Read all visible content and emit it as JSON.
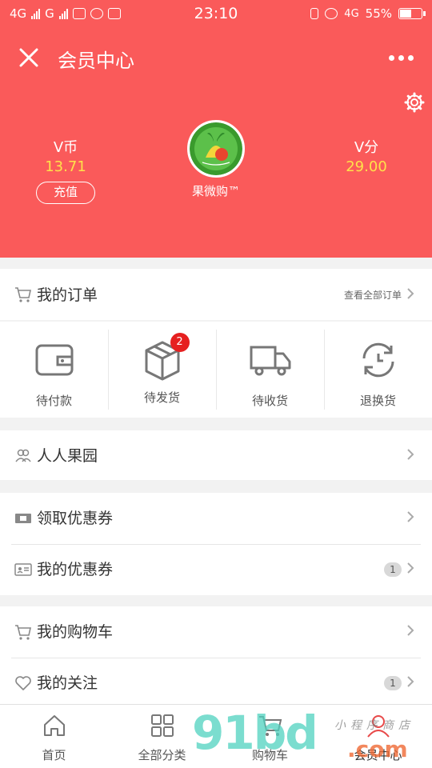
{
  "status_bar": {
    "left_net_1": "4G",
    "left_net_2": "G",
    "time": "23:10",
    "right_net": "4G",
    "battery": "55%"
  },
  "header": {
    "title": "会员中心",
    "vcoin_label": "V币",
    "vcoin_value": "13.71",
    "recharge_label": "充值",
    "vpoint_label": "V分",
    "vpoint_value": "29.00",
    "shop_name": "果微购™",
    "accent_color": "#fa5a5a",
    "value_color": "#ffe14a"
  },
  "orders": {
    "title": "我的订单",
    "view_all": "查看全部订单",
    "states": [
      {
        "label": "待付款",
        "icon": "wallet-icon"
      },
      {
        "label": "待发货",
        "icon": "box-icon",
        "badge": "2"
      },
      {
        "label": "待收货",
        "icon": "truck-icon"
      },
      {
        "label": "退换货",
        "icon": "exchange-icon"
      }
    ]
  },
  "menu": {
    "orchard": "人人果园",
    "get_coupons": "领取优惠券",
    "my_coupons": "我的优惠券",
    "my_coupons_count": "1",
    "my_cart": "我的购物车",
    "my_follow": "我的关注",
    "my_follow_count": "1"
  },
  "bottom_nav": [
    {
      "label": "首页",
      "icon": "home-icon"
    },
    {
      "label": "全部分类",
      "icon": "grid-icon"
    },
    {
      "label": "购物车",
      "icon": "cart-icon"
    },
    {
      "label": "会员中心",
      "icon": "user-icon"
    }
  ],
  "watermark": {
    "main": "91bd",
    "suffix": ".com",
    "cn": "小程序商店"
  }
}
